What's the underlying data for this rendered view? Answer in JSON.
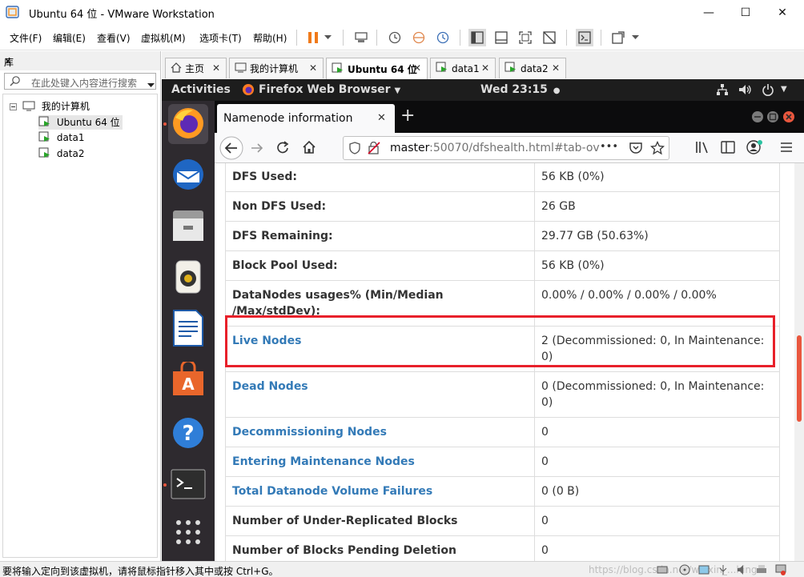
{
  "window": {
    "title": "Ubuntu 64 位 - VMware Workstation",
    "min": "—",
    "max": "☐",
    "close": "✕"
  },
  "menu": [
    "文件(F)",
    "编辑(E)",
    "查看(V)",
    "虚拟机(M)",
    "选项卡(T)",
    "帮助(H)"
  ],
  "library": {
    "title": "库",
    "close": "×",
    "search_placeholder": "在此处键入内容进行搜索",
    "tree": [
      {
        "label": "我的计算机",
        "selected": false
      },
      {
        "label": "Ubuntu 64 位",
        "selected": true
      },
      {
        "label": "data1",
        "selected": false
      },
      {
        "label": "data2",
        "selected": false
      }
    ]
  },
  "vm_tabs": [
    "主页",
    "我的计算机",
    "Ubuntu 64 位",
    "data1",
    "data2"
  ],
  "ubuntu": {
    "activities": "Activities",
    "app_menu": "Firefox Web Browser",
    "clock": "Wed 23:15",
    "clock_dot": "●"
  },
  "firefox": {
    "tab_title": "Namenode information",
    "tab_close": "✕",
    "new_tab": "+",
    "url_host": "master",
    "url_rest": ":50070/dfshealth.html#tab-ov",
    "url_more": "•••"
  },
  "table": [
    {
      "key": "DFS Used:",
      "value": "56 KB (0%)",
      "link": false
    },
    {
      "key": "Non DFS Used:",
      "value": "26 GB",
      "link": false
    },
    {
      "key": "DFS Remaining:",
      "value": "29.77 GB (50.63%)",
      "link": false
    },
    {
      "key": "Block Pool Used:",
      "value": "56 KB (0%)",
      "link": false
    },
    {
      "key": "DataNodes usages% (Min/Median /Max/stdDev):",
      "value": "0.00% / 0.00% / 0.00% / 0.00%",
      "link": false
    },
    {
      "key": "Live Nodes",
      "value": "2 (Decommissioned: 0, In Maintenance: 0)",
      "link": true
    },
    {
      "key": "Dead Nodes",
      "value": "0 (Decommissioned: 0, In Maintenance: 0)",
      "link": true
    },
    {
      "key": "Decommissioning Nodes",
      "value": "0",
      "link": true
    },
    {
      "key": "Entering Maintenance Nodes",
      "value": "0",
      "link": true
    },
    {
      "key": "Total Datanode Volume Failures",
      "value": "0 (0 B)",
      "link": true
    },
    {
      "key": "Number of Under-Replicated Blocks",
      "value": "0",
      "link": false
    },
    {
      "key": "Number of Blocks Pending Deletion",
      "value": "0",
      "link": false
    }
  ],
  "status_bar": {
    "text": "要将输入定向到该虚拟机，请将鼠标指针移入其中或按 Ctrl+G。",
    "watermark": "https://blog.csdn.net/weixin_...hing"
  },
  "colors": {
    "highlight_border": "#e8202a",
    "link": "#337ab7",
    "ubuntu_topbar": "#1d1d1d",
    "dock": "#2e2a2f"
  }
}
